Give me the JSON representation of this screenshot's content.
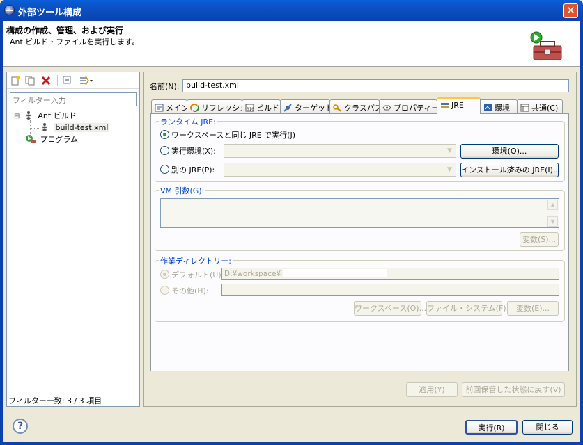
{
  "window": {
    "title": "外部ツール構成",
    "close_glyph": "✕"
  },
  "banner": {
    "heading": "構成の作成、管理、および実行",
    "message": "Ant ビルド・ファイルを実行します。"
  },
  "left": {
    "filter_placeholder": "フィルター入力",
    "tree": [
      {
        "label": "Ant ビルド",
        "expander": "⊟"
      },
      {
        "label": "build-test.xml"
      },
      {
        "label": "プログラム"
      }
    ],
    "status": "フィルター一致: 3 / 3 項目"
  },
  "right": {
    "name_label": "名前(N):",
    "name_value": "build-test.xml",
    "tabs": [
      "メイン",
      "リフレッシュ",
      "ビルド",
      "ターゲット",
      "クラスパス",
      "プロパティー",
      "JRE",
      "環境",
      "共通(C)"
    ],
    "jre": {
      "group_title": "ランタイム JRE:",
      "opt_workspace": "ワークスペースと同じ JRE で実行(J)",
      "opt_env": "実行環境(X):",
      "opt_alt": "別の JRE(P):",
      "btn_env": "環境(O)...",
      "btn_installed": "インストール済みの JRE(I)..."
    },
    "vm": {
      "group_title": "VM 引数(G):",
      "btn_vars": "変数(S)..."
    },
    "workdir": {
      "group_title": "作業ディレクトリー:",
      "opt_default": "デフォルト(U):",
      "default_value": "D:¥workspace¥",
      "opt_other": "その他(H):",
      "btn_workspace": "ワークスペース(O)...",
      "btn_filesystem": "ファイル・システム(F)...",
      "btn_vars": "変数(E)..."
    },
    "btn_apply": "適用(Y)",
    "btn_revert": "前回保管した状態に戻す(V)"
  },
  "footer": {
    "help_glyph": "?",
    "btn_run": "実行(R)",
    "btn_close": "閉じる"
  },
  "colors": {
    "titlebar": "#0a4fc0",
    "accent_blue": "#0046d5",
    "close_red": "#e2532b"
  }
}
